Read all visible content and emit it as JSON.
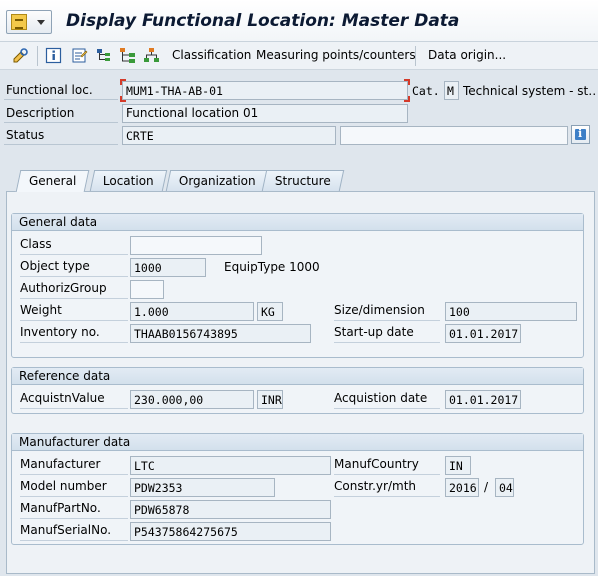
{
  "window": {
    "title": "Display Functional Location: Master Data"
  },
  "toolbar": {
    "icons": [
      "display-change-icon",
      "info-icon",
      "document-icon",
      "hierarchy-icon",
      "structure-list-icon",
      "structure-tree-icon"
    ],
    "classification_label": "Classification",
    "measuring_label": "Measuring points/counters",
    "data_origin_label": "Data origin..."
  },
  "header": {
    "funcloc_label": "Functional loc.",
    "funcloc_value": "MUM1-THA-AB-01",
    "cat_label": "Cat.",
    "cat_value": "M",
    "cat_text": "Technical system - st…",
    "description_label": "Description",
    "description_value": "Functional location 01",
    "status_label": "Status",
    "status_value": "CRTE",
    "status_value2": ""
  },
  "tabs": [
    {
      "label": "General",
      "active": true
    },
    {
      "label": "Location",
      "active": false
    },
    {
      "label": "Organization",
      "active": false
    },
    {
      "label": "Structure",
      "active": false
    }
  ],
  "general_data": {
    "title": "General data",
    "class_label": "Class",
    "class_value": "",
    "object_type_label": "Object type",
    "object_type_value": "1000",
    "equip_type_text": "EquipType 1000",
    "authoriz_label": "AuthorizGroup",
    "authoriz_value": "",
    "weight_label": "Weight",
    "weight_value": "1.000",
    "weight_unit": "KG",
    "size_label": "Size/dimension",
    "size_value": "100",
    "inventory_label": "Inventory no.",
    "inventory_value": "THAAB0156743895",
    "startup_label": "Start-up date",
    "startup_value": "01.01.2017"
  },
  "reference_data": {
    "title": "Reference data",
    "acq_value_label": "AcquistnValue",
    "acq_value": "230.000,00",
    "acq_currency": "INR",
    "acq_date_label": "Acquistion date",
    "acq_date": "01.01.2017"
  },
  "manufacturer_data": {
    "title": "Manufacturer data",
    "manufacturer_label": "Manufacturer",
    "manufacturer_value": "LTC",
    "country_label": "ManufCountry",
    "country_value": "IN",
    "model_label": "Model number",
    "model_value": "PDW2353",
    "constr_label": "Constr.yr/mth",
    "constr_year": "2016",
    "constr_sep": "/",
    "constr_month": "04",
    "part_label": "ManufPartNo.",
    "part_value": "PDW65878",
    "serial_label": "ManufSerialNo.",
    "serial_value": "P54375864275675"
  },
  "colors": {
    "focus_corner": "#d43b2a",
    "tab_bg": "#d6e2ee",
    "field_bg": "#eaf0f5"
  }
}
